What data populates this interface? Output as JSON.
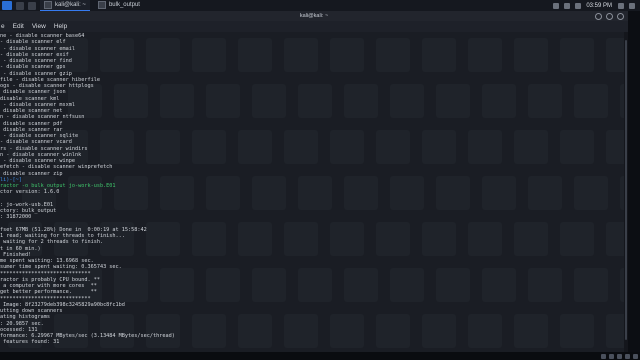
{
  "panel": {
    "tasks": [
      {
        "label": "kali@kali: ~",
        "active": true
      },
      {
        "label": "bulk_output",
        "active": false
      }
    ],
    "clock": "03:59 PM"
  },
  "window": {
    "title": "kali@kali: ~",
    "menu": [
      "e",
      "Edit",
      "View",
      "Help"
    ]
  },
  "terminal": {
    "lines": [
      "ne - disable scanner base64",
      "- disable scanner elf",
      " - disable scanner email",
      "- disable scanner exif",
      " - disable scanner find",
      "- disable scanner gps",
      " - disable scanner gzip",
      "file - disable scanner hiberfile",
      "ogs - disable scanner httplogs",
      " disable scanner json",
      "disable scanner kml",
      " - disable scanner msxml",
      " disable scanner net",
      "n - disable scanner ntfsusn",
      " disable scanner pdf",
      " disable scanner rar",
      " - disable scanner sqlite",
      "- disable scanner vcard",
      "rs - disable scanner windirs",
      "n - disable scanner winlnk",
      " - disable scanner winpe",
      "efetch - disable scanner winprefetch",
      " disable scanner zip",
      "li)-[~]",
      "ractor -o bulk_output jo-work-usb.E01",
      "ctor version: 1.6.0",
      "",
      ": jo-work-usb.E01",
      "ctory: bulk_output",
      ": 31872000",
      "",
      "fset 67MB (51.28%) Done in  0:00:19 at 15:58:42",
      "1 read; waiting for threads to finish...",
      " waiting for 2 threads to finish.",
      "t in 60 min.)",
      " Finished!",
      "me spent waiting: 13.6968 sec.",
      "sumer time spent waiting: 0.365743 sec.",
      "*****************************",
      "ractor is probably CPU bound. **",
      " a computer with more cores  **",
      "get better performance.      **",
      "*****************************",
      " Image: 8f23279deb398c3245829a90bc8fc1bd",
      "utting down scanners",
      "ating histograms",
      ": 20.9857 sec.",
      "ocessed: 131",
      "formance: 6.29967 MBytes/sec (3.13484 MBytes/sec/thread)",
      " features found: 31",
      "",
      "",
      "",
      "li)-[~]",
      "ulk_output"
    ]
  },
  "colors": {
    "terminal_bg": "#1a1d24",
    "prompt_blue": "#3b8eea",
    "prompt_green": "#3fc56b",
    "accent": "#367bf0"
  }
}
